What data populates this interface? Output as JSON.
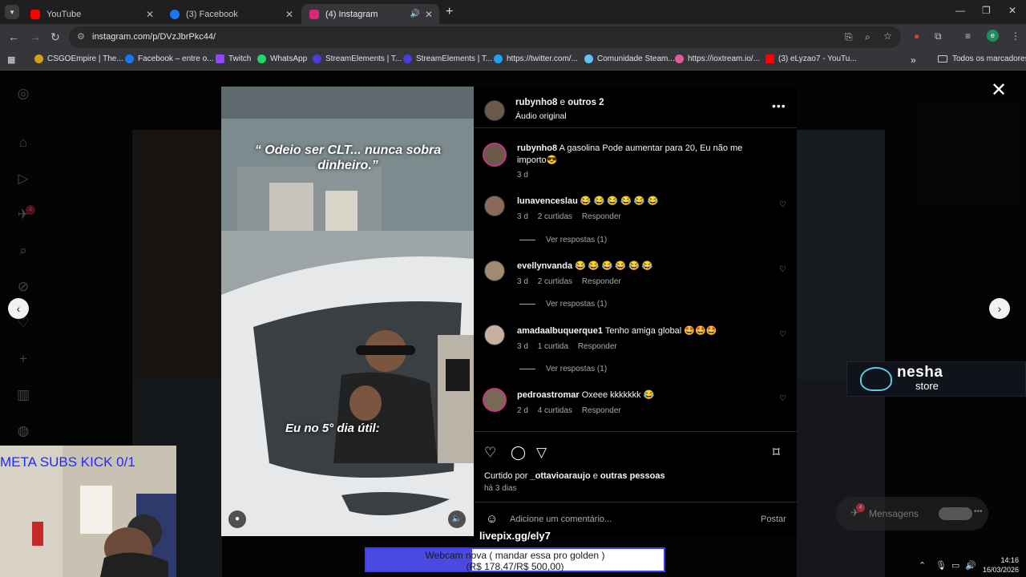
{
  "browser": {
    "tabs": [
      {
        "label": "YouTube",
        "color": "#ff0000"
      },
      {
        "label": "(3) Facebook",
        "color": "#1877f2"
      },
      {
        "label": "(4) Instagram",
        "color": "#d62976"
      }
    ],
    "url": "instagram.com/p/DVzJbrPkc44/",
    "bookmarks": [
      {
        "label": "CSGOEmpire | The...",
        "color": "#d4a017"
      },
      {
        "label": "Facebook – entre o...",
        "color": "#1877f2"
      },
      {
        "label": "Twitch",
        "color": "#9146ff"
      },
      {
        "label": "WhatsApp",
        "color": "#25d366"
      },
      {
        "label": "StreamElements | T...",
        "color": "#4b3ddb"
      },
      {
        "label": "StreamElements | T...",
        "color": "#4b3ddb"
      },
      {
        "label": "https://twitter.com/...",
        "color": "#1da1f2"
      },
      {
        "label": "Comunidade Steam...",
        "color": "#66c0f4"
      },
      {
        "label": "https://ioxtream.io/...",
        "color": "#e05aa0"
      },
      {
        "label": "(3) eLyzao7 - YouTu...",
        "color": "#ff0000"
      }
    ],
    "bookmarks_folder": "Todos os marcadores"
  },
  "post": {
    "author": "rubynho8",
    "author_suffix": "e",
    "others": "outros 2",
    "audio": "Áudio original",
    "caption_user": "rubynho8",
    "caption_text": "A gasolina Pode aumentar para 20, Eu não me importo😎",
    "caption_time": "3 d",
    "video_caption_top": "“ Odeio ser CLT... nunca sobra dinheiro.”",
    "video_caption_bottom": "Eu no 5° dia útil:",
    "comments": [
      {
        "user": "lunavenceslau",
        "text": "😂 😂 😂 😂 😂 😂",
        "time": "3 d",
        "likes": "2 curtidas",
        "reply": "Responder",
        "view": "Ver respostas (1)"
      },
      {
        "user": "evellynvanda",
        "text": "😂 😂 😂 😂 😂 😂",
        "time": "3 d",
        "likes": "2 curtidas",
        "reply": "Responder",
        "view": "Ver respostas (1)"
      },
      {
        "user": "amadaalbuquerque1",
        "text": "Tenho amiga global 🤩🤩🤩",
        "time": "3 d",
        "likes": "1 curtida",
        "reply": "Responder",
        "view": "Ver respostas (1)"
      },
      {
        "user": "pedroastromar",
        "text": "Oxeee kkkkkkk 😂",
        "time": "2 d",
        "likes": "4 curtidas",
        "reply": "Responder",
        "view": ""
      }
    ],
    "liked_by_prefix": "Curtido por",
    "liked_by_user": "_ottavioaraujo",
    "liked_by_and": "e",
    "liked_by_others": "outras pessoas",
    "posted_ago": "há 3 dias",
    "add_comment_placeholder": "Adicione um comentário...",
    "post_button": "Postar"
  },
  "sidebar": {
    "notification_badge": "4"
  },
  "messages": {
    "label": "Mensagens",
    "badge": "4"
  },
  "overlay": {
    "brand_line1": "nesha",
    "brand_line2": "store",
    "meta_subs": "META SUBS KICK 0/1",
    "livepix": "livepix.gg/ely7",
    "goal_title": "Webcam nova ( mandar essa pro golden )",
    "goal_amount": "(R$ 178,47/R$ 500,00)",
    "goal_progress": 0.357
  },
  "taskbar": {
    "time": "14:16",
    "date": "16/03/2026"
  }
}
